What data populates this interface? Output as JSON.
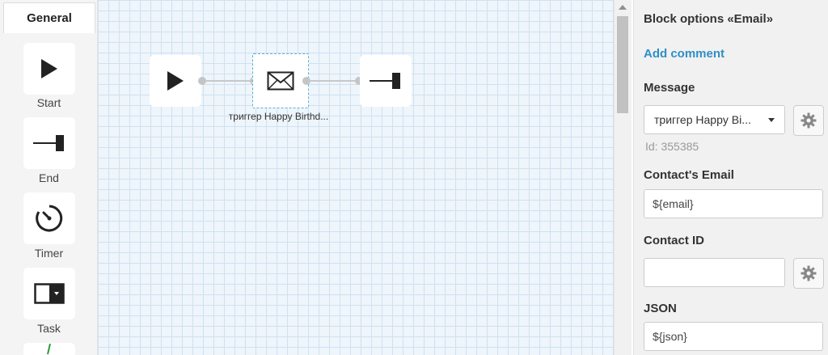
{
  "palette": {
    "tab": "General",
    "items": [
      {
        "label": "Start",
        "icon": "play-icon"
      },
      {
        "label": "End",
        "icon": "end-terminal-icon"
      },
      {
        "label": "Timer",
        "icon": "timer-icon"
      },
      {
        "label": "Task",
        "icon": "task-icon"
      }
    ]
  },
  "canvas": {
    "nodes": [
      {
        "type": "start",
        "icon": "play-icon"
      },
      {
        "type": "email",
        "icon": "envelope-icon",
        "caption": "триггер Happy Birthd..."
      },
      {
        "type": "end",
        "icon": "end-terminal-icon"
      }
    ]
  },
  "panel": {
    "title": "Block options «Email»",
    "add_comment": "Add comment",
    "message_label": "Message",
    "message_value": "триггер Happy Bi...",
    "message_id": "Id: 355385",
    "contact_email_label": "Contact's Email",
    "contact_email_value": "${email}",
    "contact_id_label": "Contact ID",
    "contact_id_value": "",
    "json_label": "JSON",
    "json_value": "${json}"
  },
  "colors": {
    "accent_link": "#2f8ec6",
    "selection_border": "#5ab0d8",
    "grid_line": "#cfe1f0",
    "canvas_bg": "#eef5fb"
  }
}
